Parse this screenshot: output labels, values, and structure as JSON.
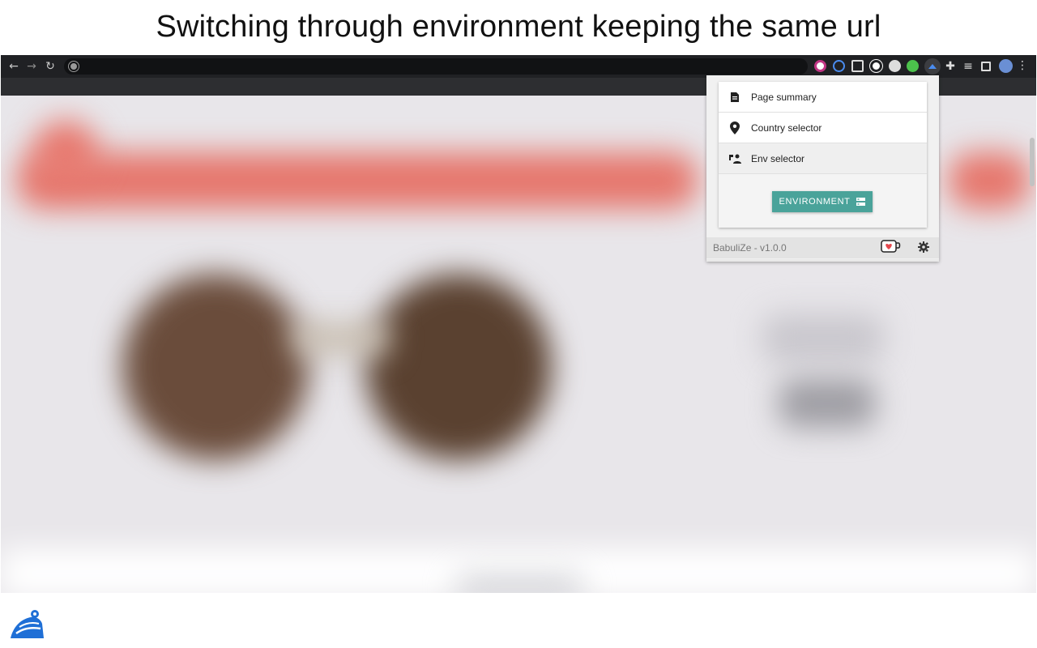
{
  "caption": "Switching through environment keeping the same url",
  "browser": {
    "toolbar": {
      "back_icon": "arrow-left-icon",
      "forward_icon": "arrow-right-icon",
      "reload_icon": "reload-icon",
      "address_value": "",
      "extensions": [
        "instagram-icon",
        "link-icon",
        "window-icon",
        "c-circle-icon",
        "puzzle-badge-icon",
        "green-badge-icon",
        "babulize-icon",
        "puzzle-icon",
        "media-icon",
        "sidepanel-icon",
        "profile-avatar"
      ]
    }
  },
  "popup": {
    "menu": [
      {
        "label": "Page summary",
        "icon": "document-icon"
      },
      {
        "label": "Country selector",
        "icon": "location-pin-icon"
      },
      {
        "label": "Env selector",
        "icon": "environment-icon"
      }
    ],
    "environment_button": "ENVIRONMENT",
    "footer": {
      "version": "BabuliZe - v1.0.0",
      "kofi_icon": "kofi-heart-cup-icon",
      "settings_icon": "gear-icon"
    }
  },
  "colors": {
    "accent_button": "#4aa39a",
    "toolbar_bg": "#202124",
    "header_blur": "#e7786d",
    "logo_blue": "#1f6fd6"
  }
}
